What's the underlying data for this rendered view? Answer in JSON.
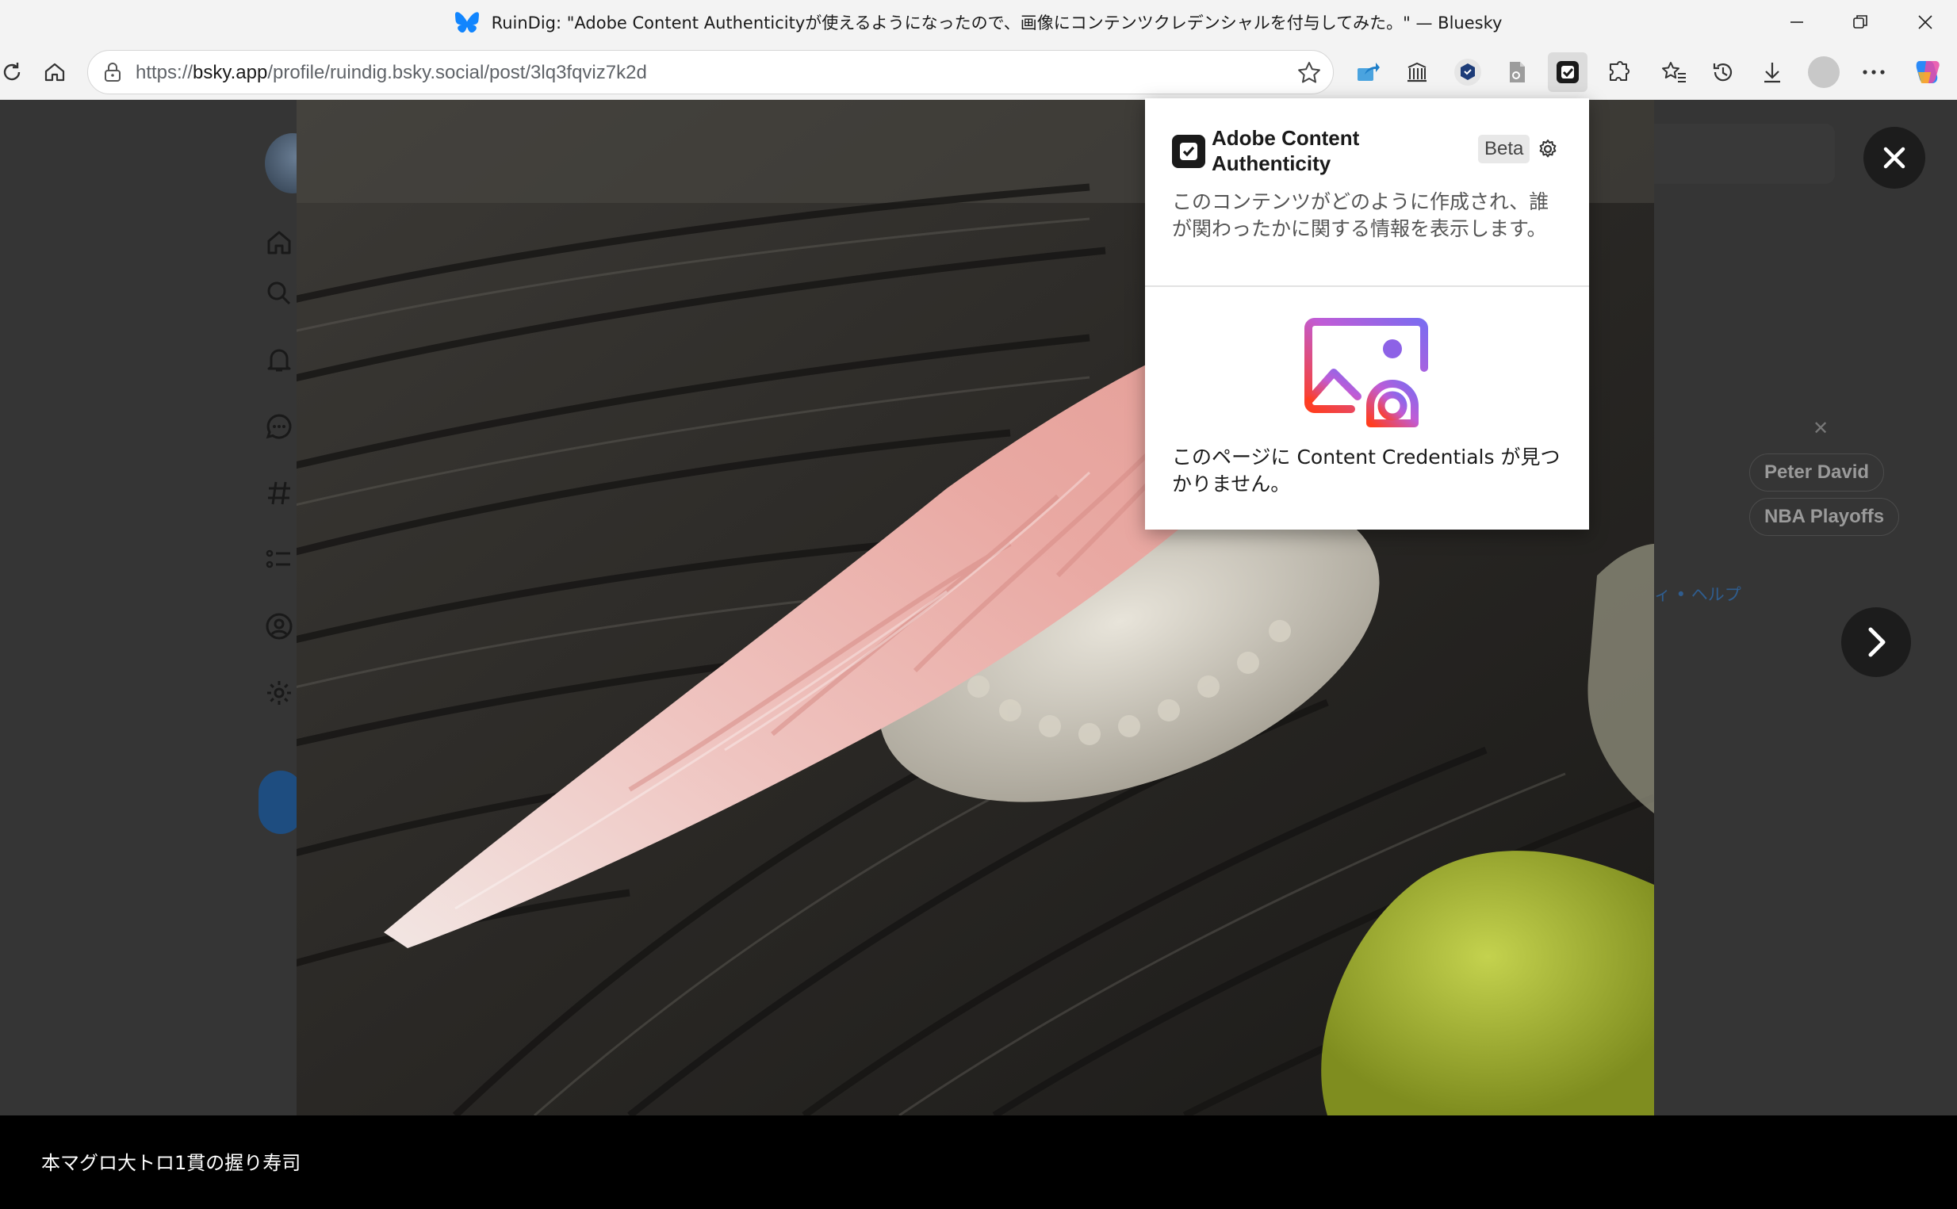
{
  "window": {
    "title": "RuinDig: \"Adobe Content Authenticityが使えるようになったので、画像にコンテンツクレデンシャルを付与してみた。\" — Bluesky"
  },
  "address_bar": {
    "url_prefix": "https://",
    "url_host": "bsky.app",
    "url_path": "/profile/ruindig.bsky.social/post/3lq3fqviz7k2d"
  },
  "toolbar_icons": [
    "reload-icon",
    "home-icon",
    "share-icon",
    "collections-icon",
    "extension-hex-icon",
    "extension-doc-icon",
    "content-authenticity-icon",
    "extensions-icon",
    "favorites-icon",
    "history-icon",
    "downloads-icon",
    "profile-avatar",
    "more-icon",
    "copilot-icon"
  ],
  "viewer": {
    "caption": "本マグロ大トロ1貫の握り寿司"
  },
  "background": {
    "trends": [
      "Peter David",
      "NBA Playoffs"
    ],
    "footer_links": "ィ • ヘルプ"
  },
  "popup": {
    "title": "Adobe Content Authenticity",
    "badge": "Beta",
    "description": "このコンテンツがどのように作成され、誰が関わったかに関する情報を表示します。",
    "message": "このページに Content Credentials が見つかりません。"
  },
  "colors": {
    "browser_chrome": "#f3f3f3",
    "viewer_bg": "#353535",
    "bluesky_blue": "#1185fe",
    "illustration_gradient": [
      "#ff3d1f",
      "#c05cd6",
      "#7b6cf0"
    ]
  }
}
